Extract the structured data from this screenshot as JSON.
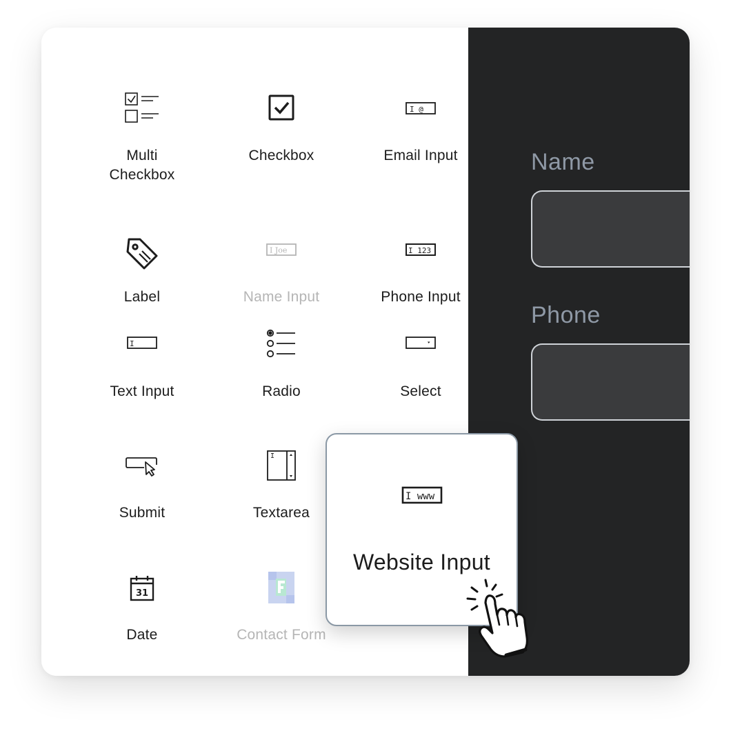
{
  "palette": {
    "items": [
      {
        "label": "Multi\nCheckbox",
        "icon": "multi-checkbox-icon",
        "disabled": false
      },
      {
        "label": "Checkbox",
        "icon": "checkbox-icon",
        "disabled": false
      },
      {
        "label": "Email Input",
        "icon": "email-input-icon",
        "disabled": false
      },
      {
        "label": "Label",
        "icon": "tag-icon",
        "disabled": false
      },
      {
        "label": "Name Input",
        "icon": "name-input-icon",
        "disabled": true
      },
      {
        "label": "Phone Input",
        "icon": "phone-input-icon",
        "disabled": false
      },
      {
        "label": "Text Input",
        "icon": "text-input-icon",
        "disabled": false
      },
      {
        "label": "Radio",
        "icon": "radio-icon",
        "disabled": false
      },
      {
        "label": "Select",
        "icon": "select-icon",
        "disabled": false
      },
      {
        "label": "Submit",
        "icon": "submit-icon",
        "disabled": false
      },
      {
        "label": "Textarea",
        "icon": "textarea-icon",
        "disabled": false
      },
      {
        "label": "Date",
        "icon": "calendar-icon",
        "disabled": false
      },
      {
        "label": "Contact Form",
        "icon": "form-logo-icon",
        "disabled": true
      }
    ],
    "icon_text": {
      "name_input": "I Joe",
      "phone_input": "I 123",
      "email_input": "I @",
      "text_input": "I",
      "date_day": "31"
    }
  },
  "dragging": {
    "label": "Website Input",
    "icon": "website-input-icon",
    "icon_text": "I www"
  },
  "preview": {
    "fields": [
      {
        "label": "Name"
      },
      {
        "label": "Phone"
      }
    ]
  },
  "colors": {
    "preview_bg": "#232425",
    "field_label": "#8f99a6",
    "field_bg": "#3a3b3d",
    "form_logo": "#c9d4f0"
  }
}
